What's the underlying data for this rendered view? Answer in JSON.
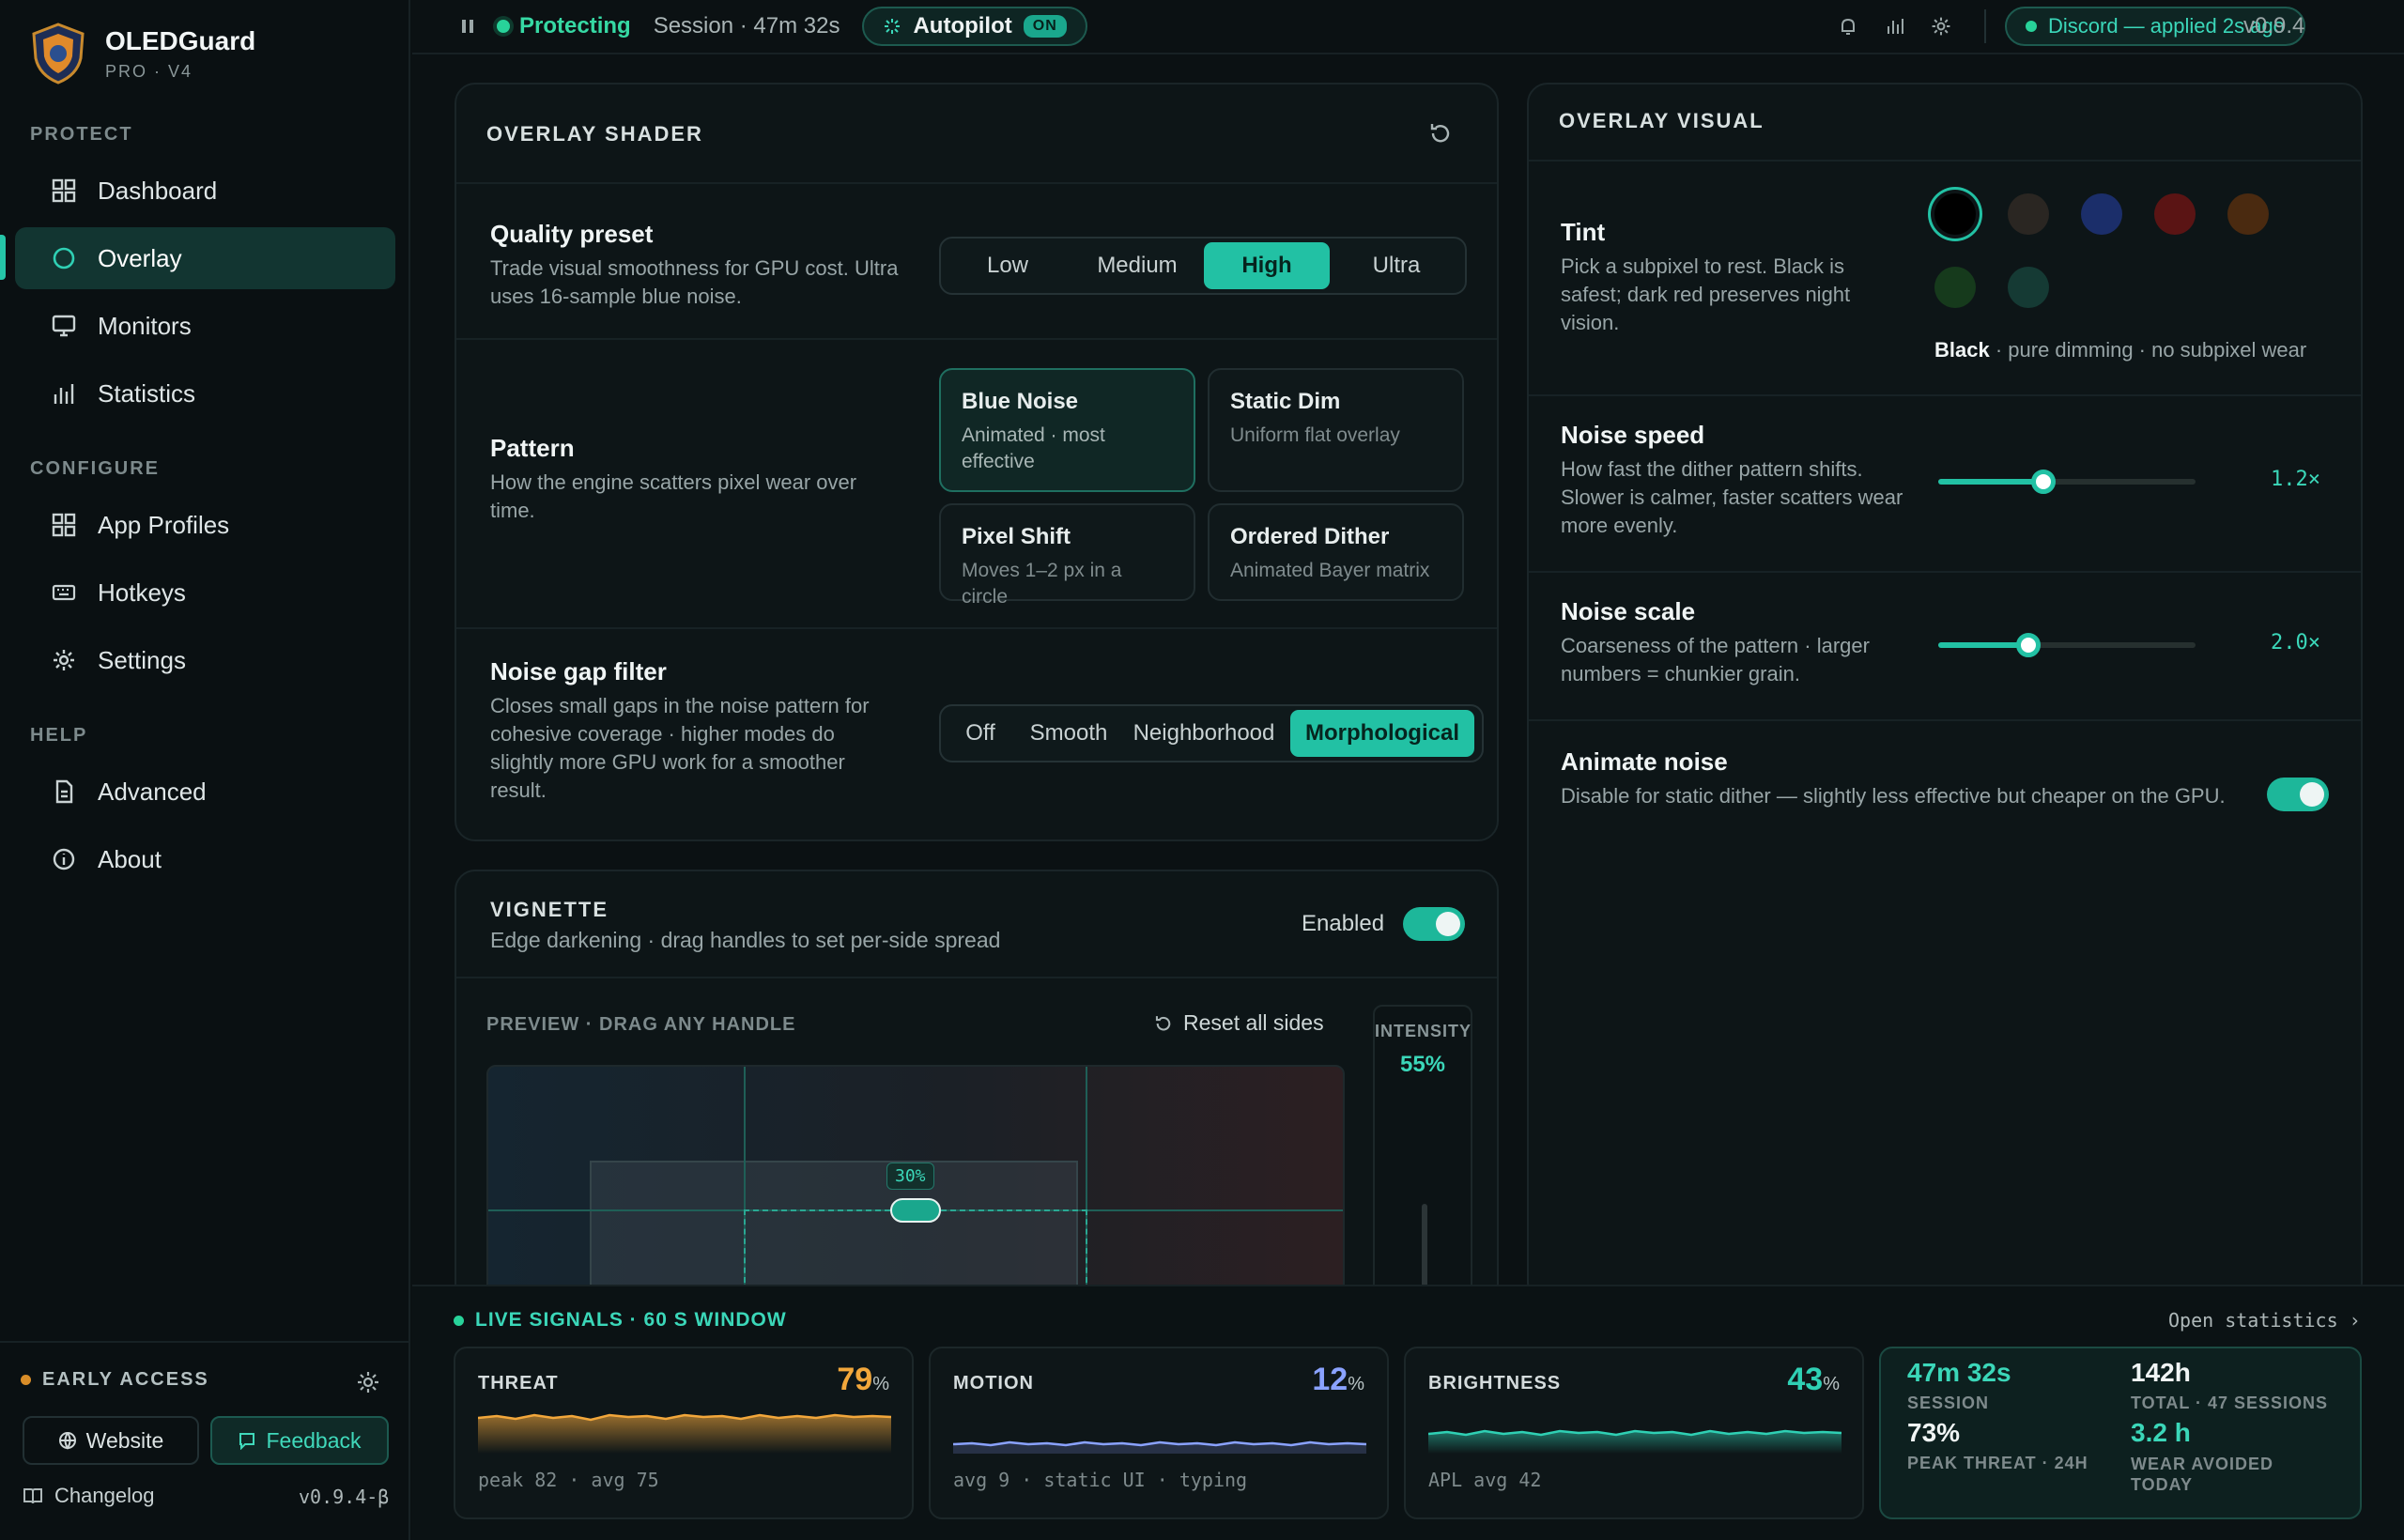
{
  "app": {
    "name": "OLEDGuard",
    "tier": "PRO · V4"
  },
  "sidebar": {
    "protect_label": "PROTECT",
    "configure_label": "CONFIGURE",
    "help_label": "HELP",
    "items": [
      {
        "label": "Dashboard",
        "icon": "grid-icon"
      },
      {
        "label": "Overlay",
        "icon": "circle-icon"
      },
      {
        "label": "Monitors",
        "icon": "monitor-icon"
      },
      {
        "label": "Statistics",
        "icon": "bar-chart-icon"
      },
      {
        "label": "App Profiles",
        "icon": "grid-icon"
      },
      {
        "label": "Hotkeys",
        "icon": "keyboard-icon"
      },
      {
        "label": "Settings",
        "icon": "gear-icon"
      },
      {
        "label": "Advanced",
        "icon": "document-icon"
      },
      {
        "label": "About",
        "icon": "info-icon"
      }
    ],
    "early_access": "EARLY ACCESS",
    "website": "Website",
    "feedback": "Feedback",
    "changelog": "Changelog",
    "version": "v0.9.4-β"
  },
  "topbar": {
    "status": "Protecting",
    "session": "Session · 47m 32s",
    "autopilot": "Autopilot",
    "autopilot_badge": "ON",
    "profile": "Discord — applied 2s ago",
    "version": "v0.9.4"
  },
  "shader": {
    "title": "OVERLAY SHADER",
    "quality": {
      "title": "Quality preset",
      "desc": "Trade visual smoothness for GPU cost. Ultra uses 16-sample blue noise.",
      "options": [
        "Low",
        "Medium",
        "High",
        "Ultra"
      ],
      "selected": "High"
    },
    "pattern": {
      "title": "Pattern",
      "desc": "How the engine scatters pixel wear over time.",
      "cards": [
        {
          "t": "Blue Noise",
          "d": "Animated · most effective"
        },
        {
          "t": "Static Dim",
          "d": "Uniform flat overlay"
        },
        {
          "t": "Pixel Shift",
          "d": "Moves 1–2 px in a circle"
        },
        {
          "t": "Ordered Dither",
          "d": "Animated Bayer matrix"
        }
      ],
      "selected": "Blue Noise"
    },
    "gap": {
      "title": "Noise gap filter",
      "desc": "Closes small gaps in the noise pattern for cohesive coverage · higher modes do slightly more GPU work for a smoother result.",
      "options": [
        "Off",
        "Smooth",
        "Neighborhood",
        "Morphological"
      ],
      "selected": "Morphological"
    }
  },
  "vignette": {
    "title": "VIGNETTE",
    "desc": "Edge darkening · drag handles to set per-side spread",
    "enabled_label": "Enabled",
    "enabled": true,
    "preview_label": "PREVIEW · DRAG ANY HANDLE",
    "reset": "Reset all sides",
    "intensity_label": "INTENSITY",
    "intensity": "55%",
    "handle_value": "30%"
  },
  "visual": {
    "title": "OVERLAY VISUAL",
    "tint": {
      "title": "Tint",
      "desc": "Pick a subpixel to rest. Black is safest; dark red preserves night vision.",
      "colors": [
        "#000000",
        "#2a2622",
        "#1b2e6a",
        "#5a1414",
        "#4a2a10",
        "#163a1c",
        "#153a34"
      ],
      "selected_name": "Black",
      "selected_desc": " · pure dimming · no subpixel wear"
    },
    "speed": {
      "title": "Noise speed",
      "desc": "How fast the dither pattern shifts. Slower is calmer, faster scatters wear more evenly.",
      "value": "1.2×",
      "fraction": 0.41
    },
    "scale": {
      "title": "Noise scale",
      "desc": "Coarseness of the pattern · larger numbers = chunkier grain.",
      "value": "2.0×",
      "fraction": 0.35
    },
    "animate": {
      "title": "Animate noise",
      "desc": "Disable for static dither — slightly less effective but cheaper on the GPU.",
      "on": true
    }
  },
  "signals": {
    "title": "LIVE SIGNALS · 60 S WINDOW",
    "open": "Open statistics",
    "threat": {
      "label": "THREAT",
      "value": "79",
      "unit": "%",
      "foot": "peak 82 · avg 75",
      "color": "#f2a73b"
    },
    "motion": {
      "label": "MOTION",
      "value": "12",
      "unit": "%",
      "foot": "avg 9 · static UI · typing",
      "color": "#8aa2ff"
    },
    "brightness": {
      "label": "BRIGHTNESS",
      "value": "43",
      "unit": "%",
      "foot": "APL avg 42",
      "color": "#2fd0b4"
    },
    "summary": {
      "session": "47m 32s",
      "session_label": "SESSION",
      "total": "142h",
      "total_label": "TOTAL · 47 SESSIONS",
      "peak": "73%",
      "peak_label": "PEAK THREAT · 24H",
      "wear": "3.2 h",
      "wear_label": "WEAR AVOIDED TODAY"
    }
  }
}
